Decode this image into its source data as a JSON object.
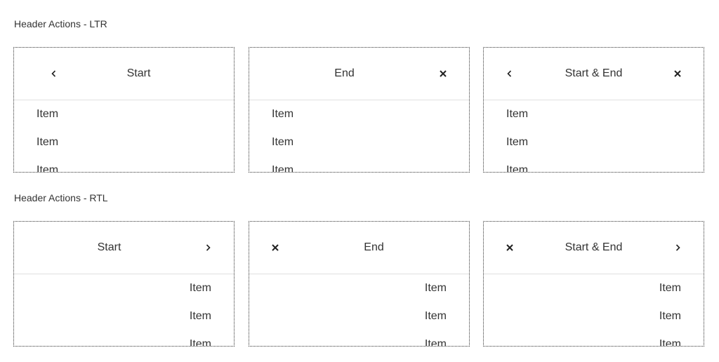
{
  "ltr": {
    "label": "Header Actions - LTR",
    "panels": [
      {
        "title": "Start",
        "start_icon": "chevron-left-icon",
        "end_icon": null,
        "items": [
          "Item",
          "Item",
          "Item"
        ]
      },
      {
        "title": "End",
        "start_icon": null,
        "end_icon": "close-icon",
        "items": [
          "Item",
          "Item",
          "Item"
        ]
      },
      {
        "title": "Start & End",
        "start_icon": "chevron-left-icon",
        "end_icon": "close-icon",
        "items": [
          "Item",
          "Item",
          "Item"
        ]
      }
    ]
  },
  "rtl": {
    "label": "Header Actions - RTL",
    "panels": [
      {
        "title": "Start",
        "start_icon": "chevron-right-icon",
        "end_icon": null,
        "items": [
          "Item",
          "Item",
          "Item"
        ]
      },
      {
        "title": "End",
        "start_icon": null,
        "end_icon": "close-icon",
        "items": [
          "Item",
          "Item",
          "Item"
        ]
      },
      {
        "title": "Start & End",
        "start_icon": "chevron-right-icon",
        "end_icon": "close-icon",
        "items": [
          "Item",
          "Item",
          "Item"
        ]
      }
    ]
  }
}
